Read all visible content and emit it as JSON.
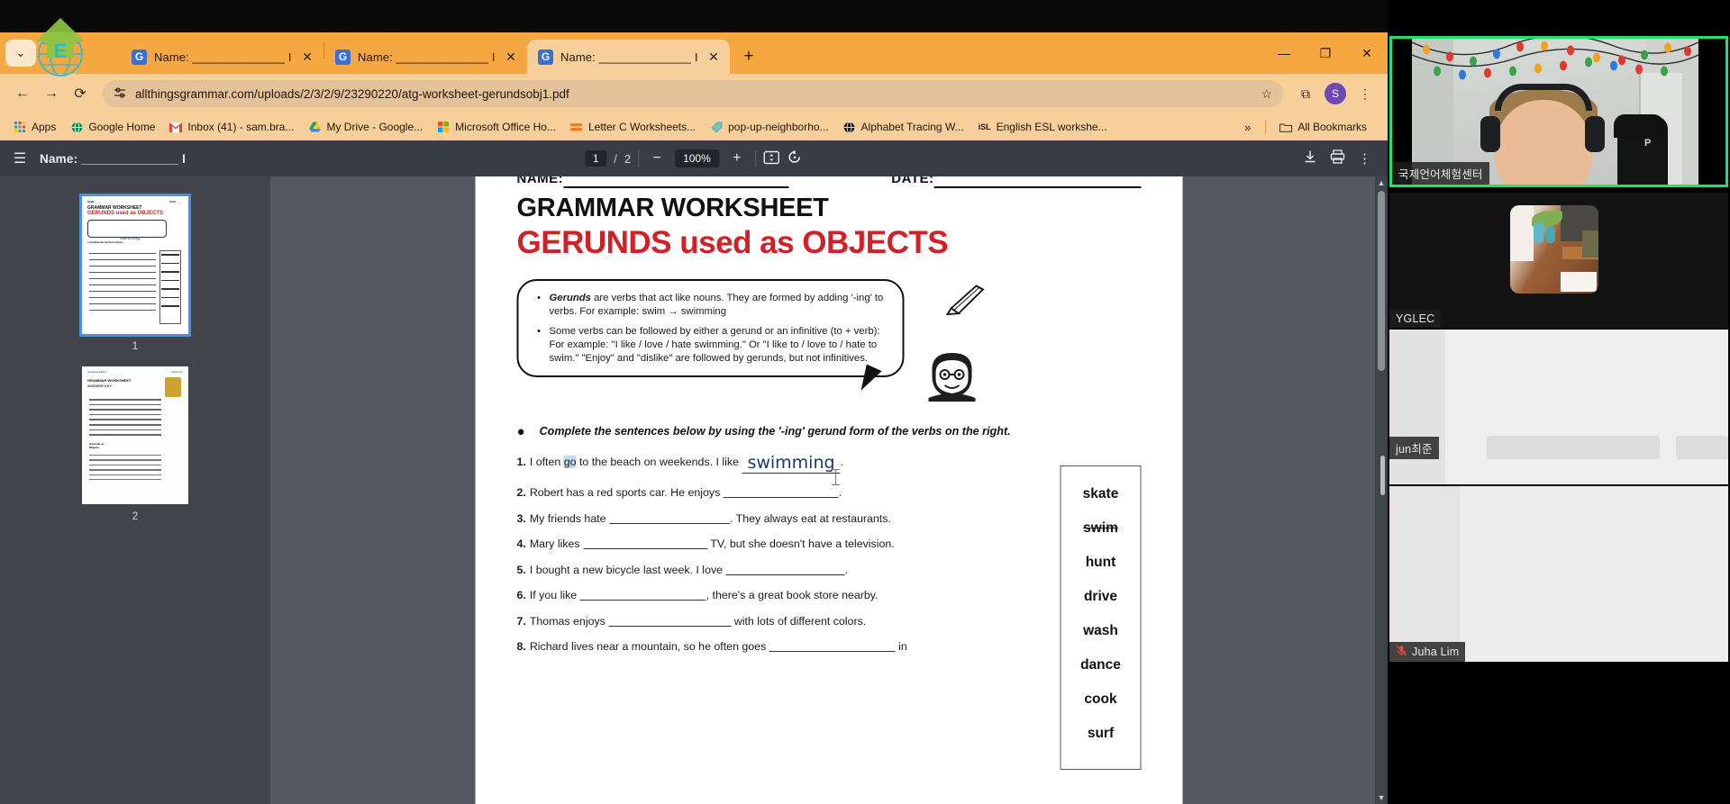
{
  "browser": {
    "tabs": [
      {
        "favicon": "G",
        "title": "Name: ______________ I",
        "close": "✕",
        "active": false
      },
      {
        "favicon": "G",
        "title": "Name: ______________ I",
        "close": "✕",
        "active": true
      }
    ],
    "tab_search_icon": "⌄",
    "new_tab_icon": "+",
    "window_controls": {
      "minimize": "—",
      "maximize": "❐",
      "close": "✕"
    },
    "nav": {
      "back_icon": "←",
      "forward_icon": "→",
      "reload_icon": "⟳",
      "site_settings_icon": "⚙",
      "url": "allthingsgrammar.com/uploads/2/3/2/9/23290220/atg-worksheet-gerundsobj1.pdf",
      "bookmark_star_icon": "☆",
      "extensions_icon": "⧉",
      "profile_initial": "S",
      "menu_icon": "⋮"
    },
    "bookmarks": {
      "items": [
        {
          "label": "Apps",
          "icon": "apps"
        },
        {
          "label": "Google Home",
          "icon": "globe"
        },
        {
          "label": "Inbox (41) - sam.bra...",
          "icon": "gmail"
        },
        {
          "label": "My Drive - Google...",
          "icon": "drive"
        },
        {
          "label": "Microsoft Office Ho...",
          "icon": "office"
        },
        {
          "label": "Letter C Worksheets...",
          "icon": "orange-doc"
        },
        {
          "label": "pop-up-neighborho...",
          "icon": "teal-tag"
        },
        {
          "label": "Alphabet Tracing W...",
          "icon": "globe-dark"
        },
        {
          "label": "English ESL workshe...",
          "icon": "isl"
        }
      ],
      "overflow_icon": "»",
      "all_bookmarks_label": "All Bookmarks",
      "all_bookmarks_icon": "folder-icon"
    }
  },
  "pdf_viewer": {
    "menu_icon": "☰",
    "document_title": "Name: ______________ I",
    "current_page": "1",
    "page_separator": "/",
    "total_pages": "2",
    "zoom_out_icon": "−",
    "zoom_level": "100%",
    "zoom_in_icon": "+",
    "fit_icon": "fit-page-icon",
    "rotate_icon": "rotate-icon",
    "download_icon": "download-icon",
    "print_icon": "print-icon",
    "more_icon": "⋮",
    "thumbnails": [
      {
        "label": "1",
        "selected": true
      },
      {
        "label": "2",
        "selected": false
      }
    ]
  },
  "worksheet": {
    "header_name_label": "NAME:",
    "header_date_label": "DATE:",
    "title_line1": "GRAMMAR WORKSHEET",
    "title_line2": "GERUNDS used as OBJECTS",
    "title_color": "#d31f26",
    "bullets": [
      "Gerunds are verbs that act like nouns.  They are formed by adding '-ing' to verbs.  For example: swim → swimming",
      "Some verbs can be followed by either a gerund or an infinitive (to + verb): For example: \"I like / love / hate swimming.\"  Or \"I like to / love to / hate to swim.\"  \"Enjoy\" and \"dislike\" are followed by gerunds, but not infinitives."
    ],
    "bullet1_lead": "Gerunds",
    "bullet1_rest": " are verbs that act like nouns.  They are formed by adding '-ing' to verbs.  For example: swim → swimming",
    "instruction_bullet": "●",
    "instruction": "Complete the sentences below by using the '-ing' gerund form of the verbs on the right.",
    "questions": [
      {
        "num": "1.",
        "pre": "I often ",
        "selected": "go",
        "mid": " to the beach on weekends.  I like ",
        "answer": "swimming",
        "post": "."
      },
      {
        "num": "2.",
        "pre": "Robert has a red sports car.  He enjoys ",
        "selected": "",
        "mid": "",
        "answer": "",
        "post": "."
      },
      {
        "num": "3.",
        "pre": "My friends hate ",
        "selected": "",
        "mid": "",
        "answer": "",
        "post": ".  They always eat at restaurants."
      },
      {
        "num": "4.",
        "pre": "Mary likes ",
        "selected": "",
        "mid": "",
        "answer": "",
        "post": " TV, but she doesn't have a television."
      },
      {
        "num": "5.",
        "pre": "I bought a new bicycle last week.  I love ",
        "selected": "",
        "mid": "",
        "answer": "",
        "post": "."
      },
      {
        "num": "6.",
        "pre": "If you like ",
        "selected": "",
        "mid": "",
        "answer": "",
        "post": ", there's a great book store nearby."
      },
      {
        "num": "7.",
        "pre": "Thomas enjoys ",
        "selected": "",
        "mid": "",
        "answer": "",
        "post": " with lots of different colors."
      },
      {
        "num": "8.",
        "pre": "Richard lives near a mountain, so he often goes ",
        "selected": "",
        "mid": "",
        "answer": "",
        "post": " in"
      }
    ],
    "word_bank": [
      {
        "word": "skate",
        "used": false
      },
      {
        "word": "swim",
        "used": true
      },
      {
        "word": "hunt",
        "used": false
      },
      {
        "word": "drive",
        "used": false
      },
      {
        "word": "wash",
        "used": false
      },
      {
        "word": "dance",
        "used": false
      },
      {
        "word": "cook",
        "used": false
      },
      {
        "word": "surf",
        "used": false
      }
    ]
  },
  "meeting": {
    "participants": [
      {
        "name": "국제언어체험센터",
        "speaking": true,
        "muted": false
      },
      {
        "name": "YGLEC",
        "speaking": false,
        "muted": false
      },
      {
        "name": "jun최준",
        "speaking": false,
        "muted": false
      },
      {
        "name": "Juha Lim",
        "speaking": false,
        "muted": true
      }
    ],
    "muted_icon": "mic-off-icon",
    "active_speaker_border_color": "#22e06a"
  }
}
